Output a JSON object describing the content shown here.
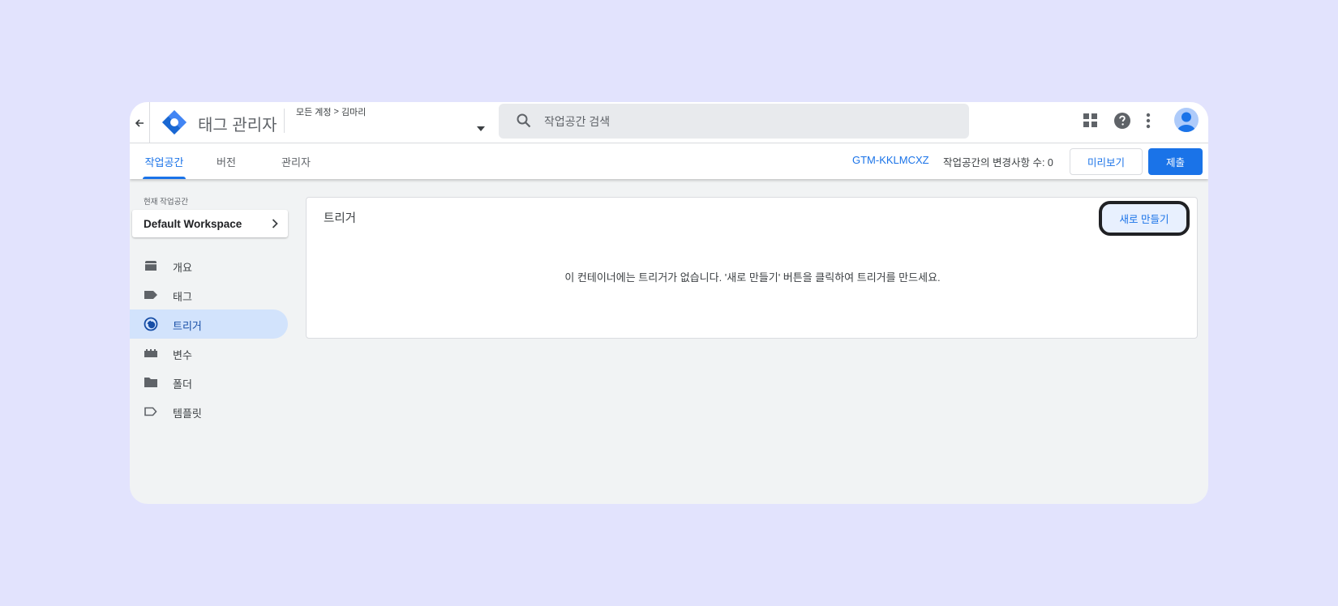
{
  "header": {
    "back_icon": "arrow-left-icon",
    "logo_icon": "tag-manager-logo",
    "app_title": "태그 관리자",
    "breadcrumb": {
      "root": "모든 계정",
      "separator": ">",
      "account": "김마리"
    },
    "dropdown_icon": "caret-down-icon",
    "search": {
      "icon": "search-icon",
      "placeholder": "작업공간 검색",
      "value": ""
    },
    "icons": [
      "apps-grid-icon",
      "help-icon",
      "more-vert-icon",
      "account-avatar"
    ]
  },
  "tabs": [
    {
      "label": "작업공간",
      "active": true
    },
    {
      "label": "버전",
      "active": false
    },
    {
      "label": "관리자",
      "active": false
    }
  ],
  "toolbar": {
    "container_id": "GTM-KKLMCXZ",
    "changes_text": "작업공간의 변경사항 수: 0",
    "preview_label": "미리보기",
    "submit_label": "제출"
  },
  "sidebar": {
    "current_workspace_label": "현재 작업공간",
    "workspace_name": "Default Workspace",
    "items": [
      {
        "label": "개요",
        "icon": "overview-icon",
        "active": false
      },
      {
        "label": "태그",
        "icon": "tag-icon",
        "active": false
      },
      {
        "label": "트리거",
        "icon": "trigger-icon",
        "active": true
      },
      {
        "label": "변수",
        "icon": "variable-icon",
        "active": false
      },
      {
        "label": "폴더",
        "icon": "folder-icon",
        "active": false
      },
      {
        "label": "템플릿",
        "icon": "template-icon",
        "active": false
      }
    ]
  },
  "main": {
    "title": "트리거",
    "new_button_label": "새로 만들기",
    "empty_message": "이 컨테이너에는 트리거가 없습니다. '새로 만들기' 버튼을 클릭하여 트리거를 만드세요."
  },
  "colors": {
    "background": "#e2e3fd",
    "accent": "#1a73e8",
    "active_nav": "#d2e3fc"
  }
}
